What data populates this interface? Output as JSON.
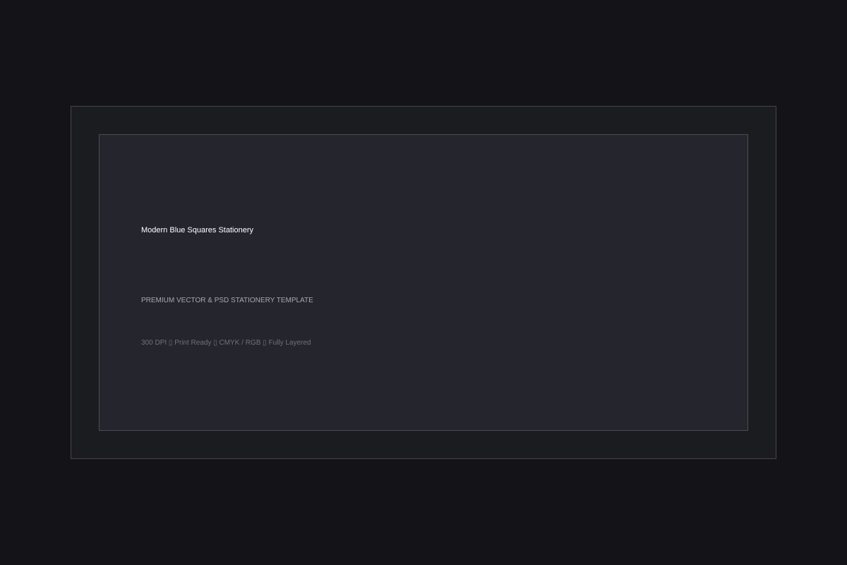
{
  "card": {
    "title": "Modern Blue Squares Stationery",
    "subtitle": "PREMIUM VECTOR & PSD STATIONERY TEMPLATE",
    "specs": "300 DPI ▯ Print Ready ▯ CMYK / RGB ▯ Fully Layered"
  },
  "colors": {
    "page_background": "#131318",
    "frame_background": "#1b1c20",
    "panel_background": "#25252e",
    "title_text": "#ffffff",
    "subtitle_text": "#a7a8b0",
    "specs_text": "#707179"
  }
}
